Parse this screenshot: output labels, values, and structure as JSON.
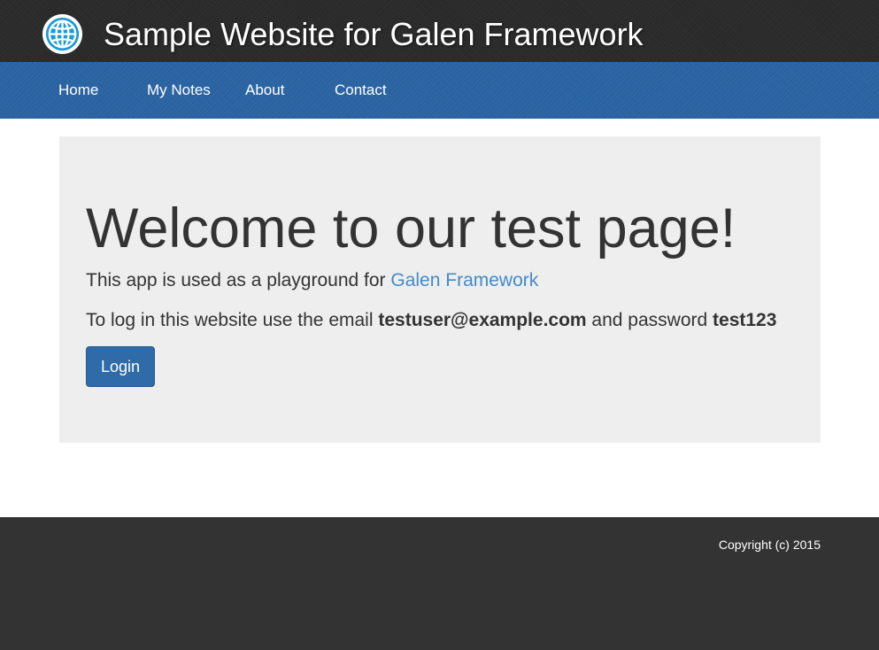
{
  "header": {
    "title": "Sample Website for Galen Framework",
    "logo_icon": "globe-icon"
  },
  "nav": {
    "items": [
      {
        "label": "Home"
      },
      {
        "label": "My Notes"
      },
      {
        "label": "About"
      },
      {
        "label": "Contact"
      }
    ]
  },
  "main": {
    "heading": "Welcome to our test page!",
    "intro_text": "This app is used as a playground for ",
    "intro_link": "Galen Framework",
    "creds_prefix": "To log in this website use the email ",
    "email": "testuser@example.com",
    "creds_middle": " and password ",
    "password": "test123",
    "login_label": "Login"
  },
  "footer": {
    "copyright": "Copyright (c) 2015"
  },
  "colors": {
    "header_bg": "#2a2a2a",
    "nav_bg": "#2a64a3",
    "jumbotron_bg": "#eeeeee",
    "link": "#428bca",
    "button": "#2e6ba8",
    "footer_bg": "#333333"
  }
}
